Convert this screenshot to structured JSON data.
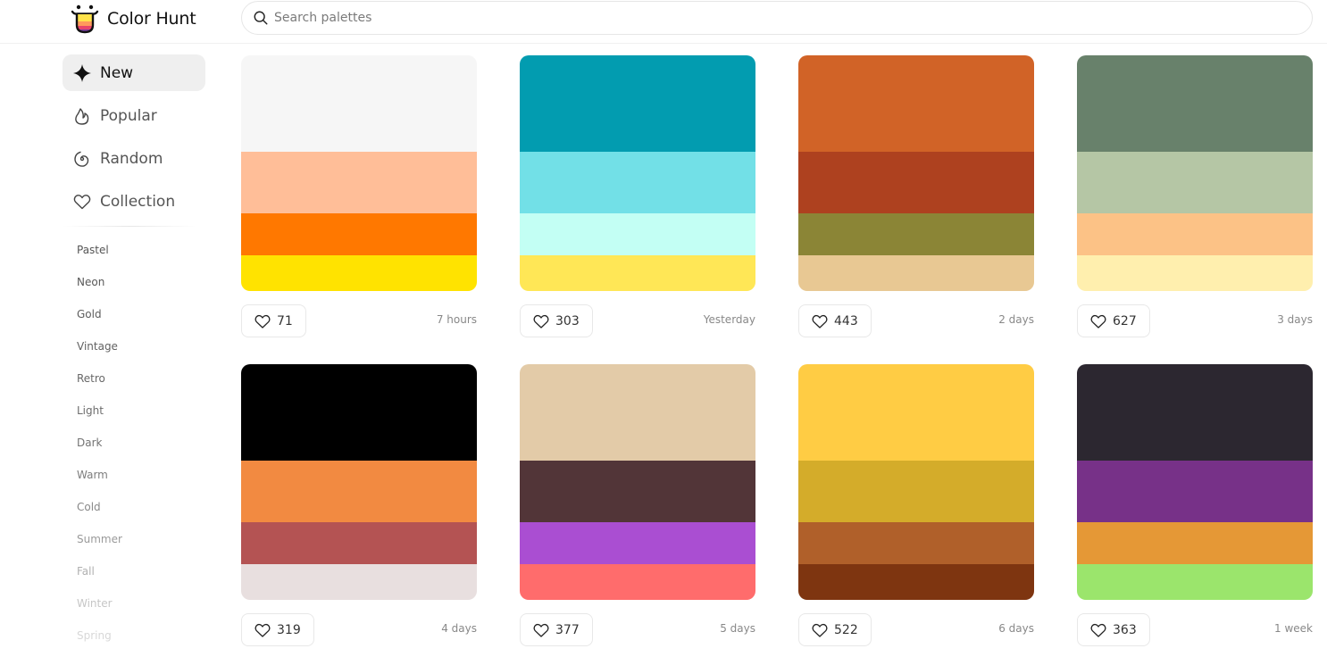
{
  "header": {
    "logo_text": "Color Hunt",
    "search_placeholder": "Search palettes",
    "search_value": ""
  },
  "sidebar": {
    "nav": [
      {
        "label": "New",
        "icon": "sparkle-icon",
        "active": true
      },
      {
        "label": "Popular",
        "icon": "flame-icon",
        "active": false
      },
      {
        "label": "Random",
        "icon": "spiral-icon",
        "active": false
      },
      {
        "label": "Collection",
        "icon": "heart-icon",
        "active": false
      }
    ],
    "tags": [
      {
        "label": "Pastel",
        "color": "#555555"
      },
      {
        "label": "Neon",
        "color": "#585858"
      },
      {
        "label": "Gold",
        "color": "#5d5d5d"
      },
      {
        "label": "Vintage",
        "color": "#626262"
      },
      {
        "label": "Retro",
        "color": "#686868"
      },
      {
        "label": "Light",
        "color": "#6d6d6d"
      },
      {
        "label": "Dark",
        "color": "#737373"
      },
      {
        "label": "Warm",
        "color": "#7d7d7d"
      },
      {
        "label": "Cold",
        "color": "#888888"
      },
      {
        "label": "Summer",
        "color": "#9a9a9a"
      },
      {
        "label": "Fall",
        "color": "#b0b0b0"
      },
      {
        "label": "Winter",
        "color": "#c6c6c6"
      },
      {
        "label": "Spring",
        "color": "#d8d8d8"
      }
    ]
  },
  "palettes": [
    {
      "colors": [
        "#F6F6F6",
        "#FFBE98",
        "#FF7800",
        "#FFE300"
      ],
      "likes": "71",
      "date": "7 hours"
    },
    {
      "colors": [
        "#029CB0",
        "#72E0E7",
        "#C3FFF4",
        "#FFE756"
      ],
      "likes": "303",
      "date": "Yesterday"
    },
    {
      "colors": [
        "#D16327",
        "#AE411F",
        "#8B8536",
        "#E8C893"
      ],
      "likes": "443",
      "date": "2 days"
    },
    {
      "colors": [
        "#68816B",
        "#B5C6A5",
        "#FCC286",
        "#FFEFAE"
      ],
      "likes": "627",
      "date": "3 days"
    },
    {
      "colors": [
        "#000000",
        "#F28A41",
        "#B45353",
        "#E8DFDF"
      ],
      "likes": "319",
      "date": "4 days"
    },
    {
      "colors": [
        "#E3CBA8",
        "#523538",
        "#AA4ED2",
        "#FF6C6C"
      ],
      "likes": "377",
      "date": "5 days"
    },
    {
      "colors": [
        "#FFCC44",
        "#D4AC2A",
        "#B0602A",
        "#7E3510"
      ],
      "likes": "522",
      "date": "6 days"
    },
    {
      "colors": [
        "#2C2730",
        "#773188",
        "#E59836",
        "#9BE56C"
      ],
      "likes": "363",
      "date": "1 week"
    }
  ]
}
